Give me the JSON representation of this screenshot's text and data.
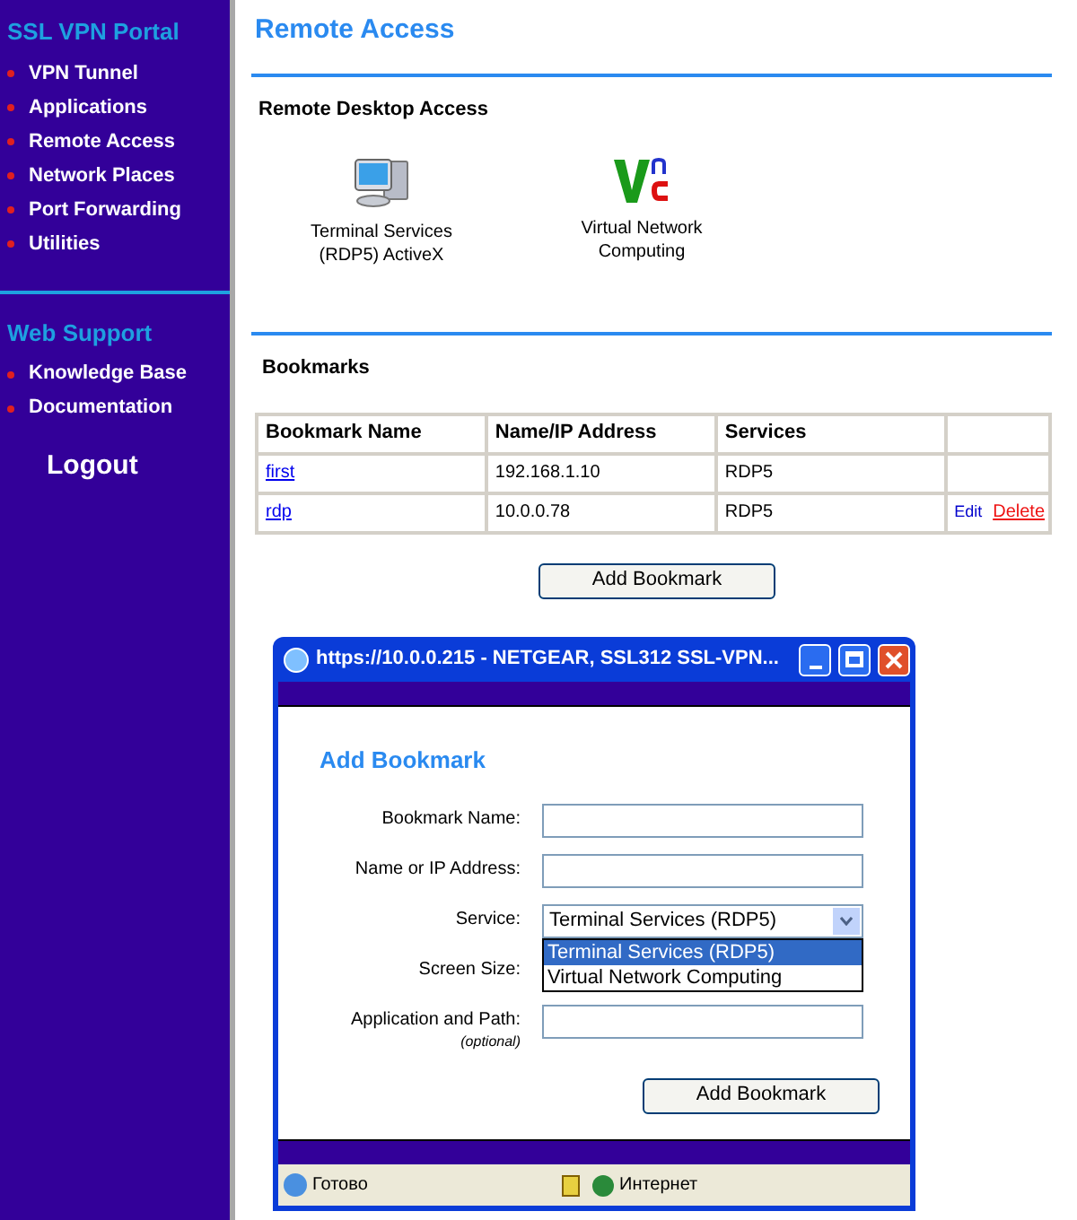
{
  "sidebar": {
    "sections": [
      {
        "title": "SSL VPN Portal",
        "items": [
          {
            "label": "VPN Tunnel"
          },
          {
            "label": "Applications"
          },
          {
            "label": "Remote Access"
          },
          {
            "label": "Network Places"
          },
          {
            "label": "Port Forwarding"
          },
          {
            "label": "Utilities"
          }
        ]
      },
      {
        "title": "Web Support",
        "items": [
          {
            "label": "Knowledge Base"
          },
          {
            "label": "Documentation"
          }
        ]
      }
    ],
    "logout": "Logout"
  },
  "page_title": "Remote Access",
  "remote_desktop": {
    "heading": "Remote Desktop Access",
    "apps": [
      {
        "kind": "terminal",
        "label": "Terminal Services (RDP5) ActiveX"
      },
      {
        "kind": "vnc",
        "label": "Virtual Network Computing"
      }
    ]
  },
  "bookmarks": {
    "heading": "Bookmarks",
    "columns": [
      "Bookmark Name",
      "Name/IP Address",
      "Services"
    ],
    "rows": [
      {
        "name": "first",
        "address": "192.168.1.10",
        "service": "RDP5",
        "actions": []
      },
      {
        "name": "rdp",
        "address": "10.0.0.78",
        "service": "RDP5",
        "actions": [
          {
            "kind": "edit",
            "label": "Edit"
          },
          {
            "kind": "delete",
            "label": "Delete"
          }
        ]
      }
    ],
    "add_button": "Add Bookmark"
  },
  "popup": {
    "title": "https://10.0.0.215 - NETGEAR, SSL312 SSL-VPN...",
    "heading": "Add Bookmark",
    "fields": [
      {
        "kind": "text",
        "label": "Bookmark Name:"
      },
      {
        "kind": "text",
        "label": "Name or IP Address:"
      },
      {
        "kind": "select",
        "label": "Service:",
        "value": "Terminal Services (RDP5)",
        "options": [
          {
            "label": "Terminal Services (RDP5)",
            "selected": true
          },
          {
            "label": "Virtual Network Computing",
            "selected": false
          }
        ]
      },
      {
        "kind": "hidden",
        "label": "Screen Size:"
      },
      {
        "kind": "text",
        "label": "Application and Path:",
        "note": "(optional)"
      }
    ],
    "submit": "Add Bookmark",
    "status": "Готово",
    "zone": "Интернет"
  }
}
